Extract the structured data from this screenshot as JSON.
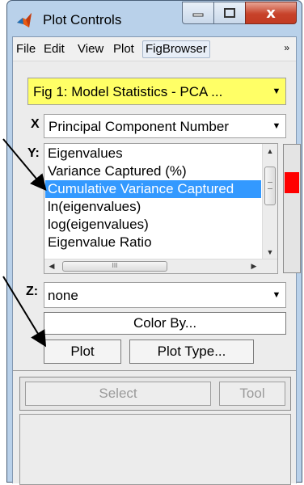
{
  "window": {
    "title": "Plot Controls",
    "icon": "matlab-icon",
    "controls": {
      "minimize": "—",
      "maximize": "▢",
      "close": "x"
    }
  },
  "menu": {
    "items": [
      "File",
      "Edit",
      "View",
      "Plot",
      "FigBrowser"
    ],
    "overflow": "»"
  },
  "figure_select": {
    "value": "Fig 1: Model Statistics - PCA ...",
    "bg": "#ffff66"
  },
  "x_axis": {
    "label": "X",
    "value": "Principal Component Number"
  },
  "y_axis": {
    "label": "Y:",
    "items": [
      "Eigenvalues",
      "Variance Captured (%)",
      "Cumulative Variance Captured",
      "ln(eigenvalues)",
      "log(eigenvalues)",
      "Eigenvalue Ratio"
    ],
    "selected_index": 2,
    "selection_color": "#3399ff"
  },
  "slider": {
    "knob_color": "#ff0000"
  },
  "z_axis": {
    "label": "Z:",
    "value": "none"
  },
  "buttons": {
    "color_by": "Color By...",
    "plot": "Plot",
    "plot_type": "Plot Type...",
    "select": "Select",
    "tool": "Tool"
  }
}
